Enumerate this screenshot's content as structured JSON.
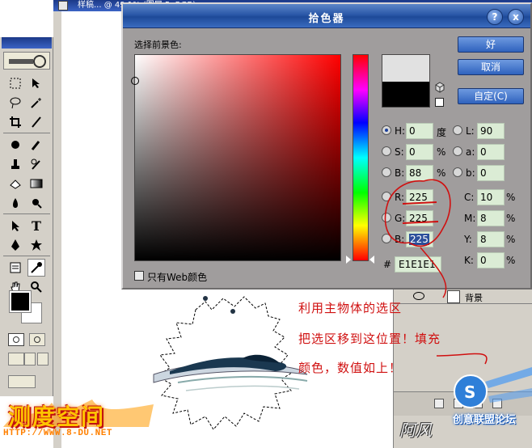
{
  "document": {
    "title": "样稿... @ 49.1% (图层 5, RGB)"
  },
  "dialog": {
    "title": "拾色器",
    "section_label": "选择前景色:",
    "help_symbol": "?",
    "close_symbol": "x",
    "buttons": {
      "ok": "好",
      "cancel": "取消",
      "custom": "自定(C)"
    },
    "colors": {
      "new_color": "#e1e1e1",
      "current_color": "#000000",
      "hue_base": "#ff0000"
    },
    "hsb": [
      {
        "label": "H:",
        "value": "0",
        "unit": "度",
        "checked": true
      },
      {
        "label": "S:",
        "value": "0",
        "unit": "%",
        "checked": false
      },
      {
        "label": "B:",
        "value": "88",
        "unit": "%",
        "checked": false
      }
    ],
    "lab": [
      {
        "label": "L:",
        "value": "90"
      },
      {
        "label": "a:",
        "value": "0"
      },
      {
        "label": "b:",
        "value": "0"
      }
    ],
    "rgb": [
      {
        "label": "R:",
        "value": "225"
      },
      {
        "label": "G:",
        "value": "225"
      },
      {
        "label": "B:",
        "value": "225"
      }
    ],
    "cmyk": [
      {
        "label": "C:",
        "value": "10",
        "unit": "%"
      },
      {
        "label": "M:",
        "value": "8",
        "unit": "%"
      },
      {
        "label": "Y:",
        "value": "8",
        "unit": "%"
      },
      {
        "label": "K:",
        "value": "0",
        "unit": "%"
      }
    ],
    "hex_label": "#",
    "hex_value": "E1E1E1",
    "web_only_label": "只有Web颜色"
  },
  "layers_panel": {
    "layer_name": "背景"
  },
  "annotation": {
    "lines": [
      "利用主物体的选区",
      "把选区移到这位置！填充",
      "颜色，数值如上！"
    ],
    "color": "#d01010"
  },
  "watermarks": {
    "left_logo": "测度空间",
    "left_url": "HTTP://WWW.8-DU.NET",
    "signature": "阿风",
    "right_logo": "创意联盟论坛"
  }
}
